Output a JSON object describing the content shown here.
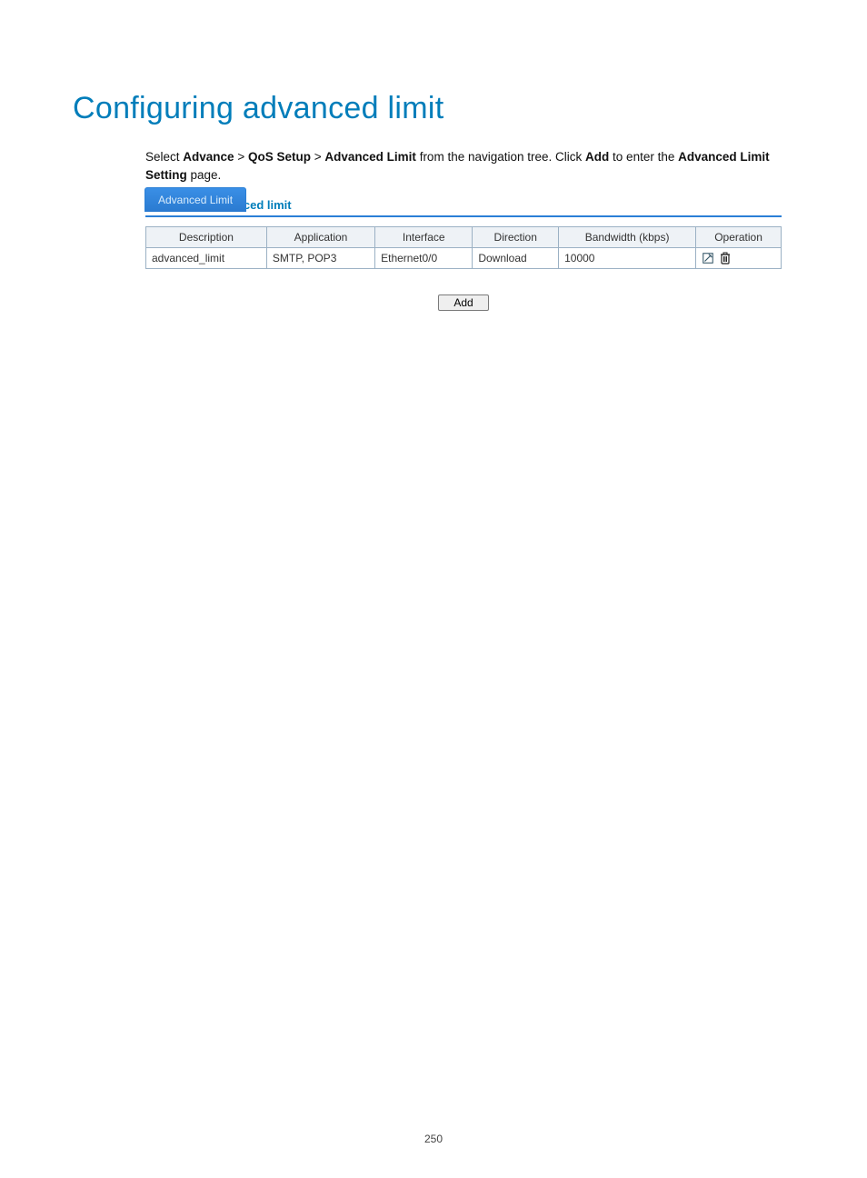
{
  "page": {
    "title": "Configuring advanced limit",
    "number": "250"
  },
  "intro": {
    "prefix": "Select ",
    "b1": "Advance",
    "sep1": " > ",
    "b2": "QoS Setup",
    "sep2": " > ",
    "b3": "Advanced Limit",
    "mid": " from the navigation tree. Click ",
    "b4": "Add",
    "mid2": " to enter the ",
    "b5": "Advanced Limit Setting",
    "suffix": " page."
  },
  "figure": {
    "caption": "Figure 252 Advanced limit",
    "tab_label": "Advanced Limit"
  },
  "table": {
    "headers": {
      "description": "Description",
      "application": "Application",
      "interface": "Interface",
      "direction": "Direction",
      "bandwidth": "Bandwidth (kbps)",
      "operation": "Operation"
    },
    "rows": [
      {
        "description": "advanced_limit",
        "application": "SMTP, POP3",
        "interface": "Ethernet0/0",
        "direction": "Download",
        "bandwidth": "10000"
      }
    ]
  },
  "buttons": {
    "add": "Add"
  }
}
